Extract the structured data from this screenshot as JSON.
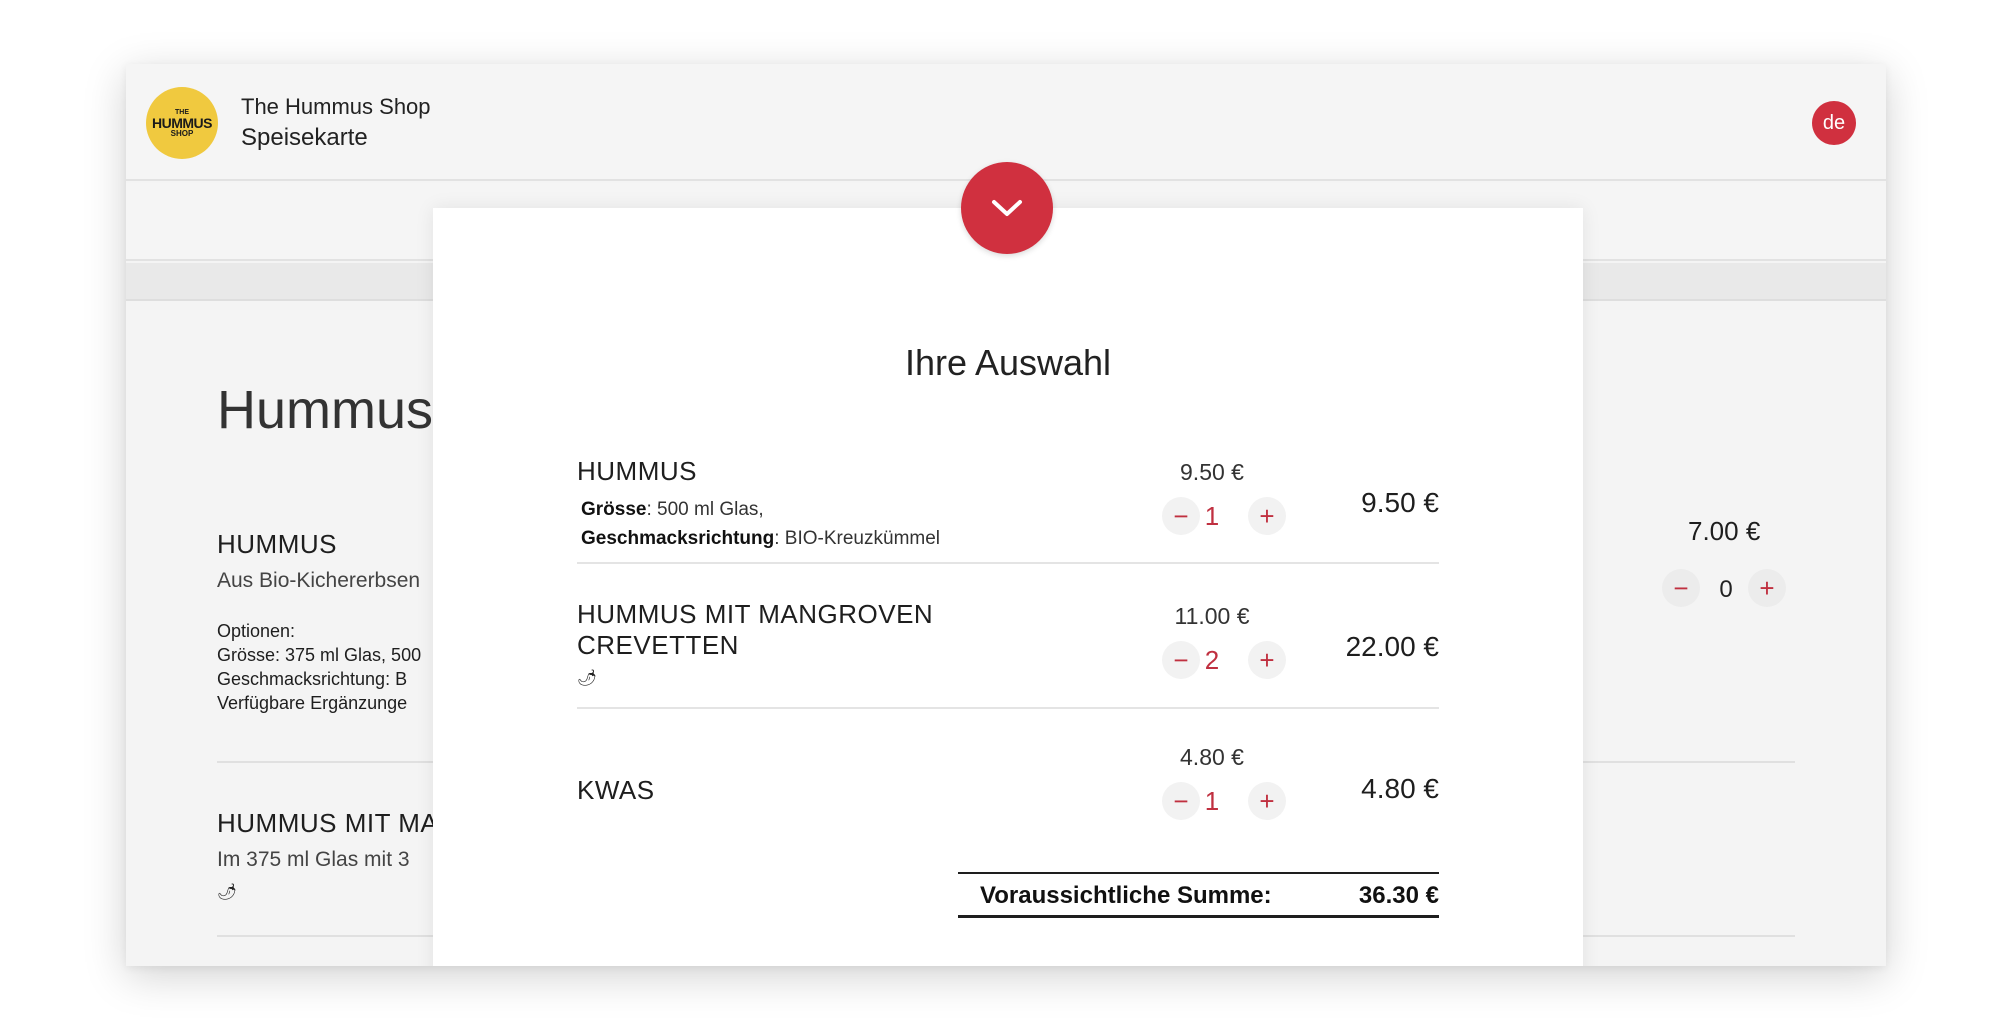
{
  "header": {
    "logo_line1": "THE",
    "logo_line2": "HUMMUS",
    "logo_line3": "SHOP",
    "shop_name": "The Hummus Shop",
    "subtitle": "Speisekarte",
    "language": "de"
  },
  "menu": {
    "category_title": "Hummus",
    "items": [
      {
        "name": "HUMMUS",
        "description": "Aus Bio-Kichererbsen",
        "options_heading": "Optionen:",
        "options": [
          "Grösse: 375 ml Glas, 500",
          "Geschmacksrichtung: B",
          "Verfügbare Ergänzunge"
        ],
        "price": "7.00 €",
        "quantity": "0",
        "minus_symbol": "−",
        "plus_symbol": "+"
      },
      {
        "name": "HUMMUS MIT MA",
        "description": "Im 375 ml Glas mit 3",
        "spicy_icon": "chili-pepper-icon"
      }
    ]
  },
  "cart": {
    "collapse_icon": "chevron-down-icon",
    "title": "Ihre Auswahl",
    "items": [
      {
        "name": "HUMMUS",
        "options": [
          {
            "label": "Grösse",
            "value": ": 500 ml Glas,"
          },
          {
            "label": "Geschmacksrichtung",
            "value": ": BIO-Kreuzkümmel"
          }
        ],
        "unit_price": "9.50 €",
        "quantity": "1",
        "total": "9.50 €"
      },
      {
        "name_line1": "HUMMUS MIT MANGROVEN",
        "name_line2": "CREVETTEN",
        "spicy_icon": "chili-pepper-icon",
        "unit_price": "11.00 €",
        "quantity": "2",
        "total": "22.00 €"
      },
      {
        "name": "KWAS",
        "unit_price": "4.80 €",
        "quantity": "1",
        "total": "4.80 €"
      }
    ],
    "minus_symbol": "−",
    "plus_symbol": "+",
    "sum_label": "Voraussichtliche Summe:",
    "sum_value": "36.30 €"
  },
  "colors": {
    "accent": "#d0303f",
    "logo_yellow": "#f0c93f"
  }
}
